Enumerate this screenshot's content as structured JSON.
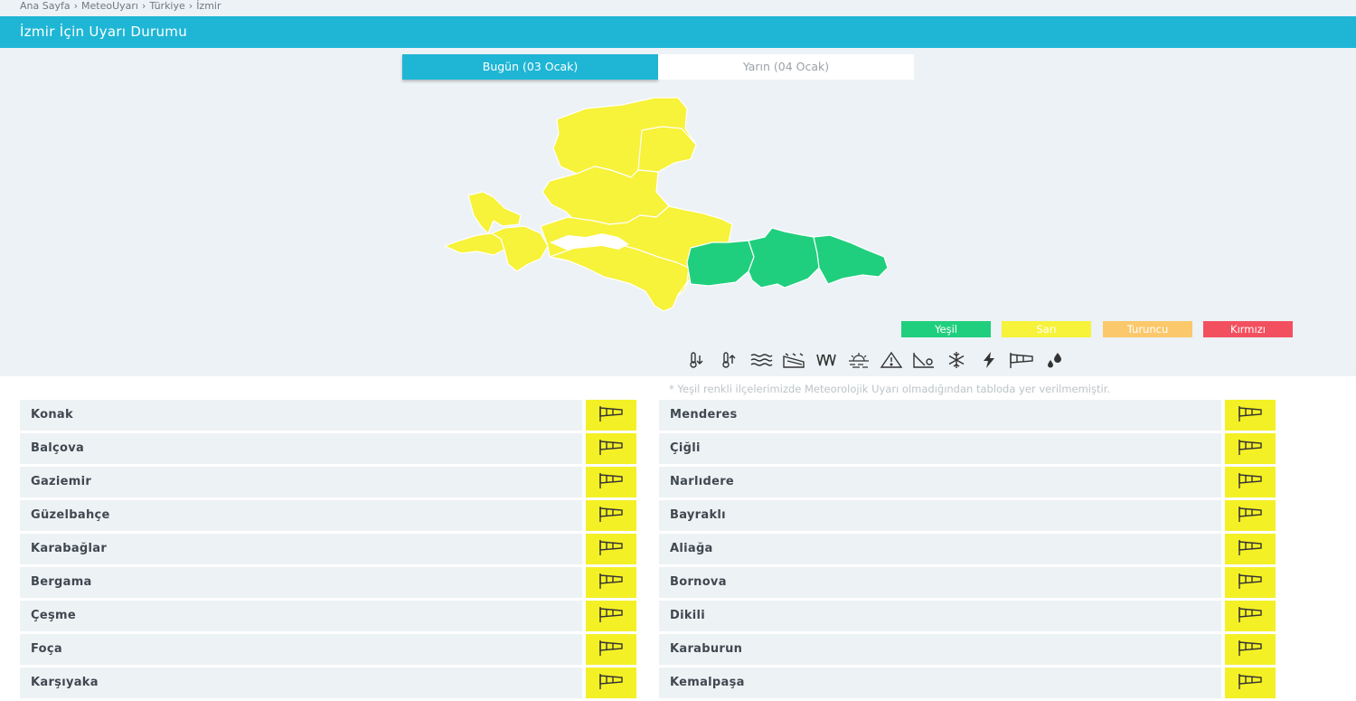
{
  "breadcrumb": [
    "Ana Sayfa",
    "MeteoUyarı",
    "Türkiye",
    "İzmir"
  ],
  "breadcrumb_sep": "›",
  "title": "İzmir İçin Uyarı Durumu",
  "tabs": [
    {
      "label": "Bugün (03 Ocak)",
      "active": true
    },
    {
      "label": "Yarın (04 Ocak)",
      "active": false
    }
  ],
  "legend": [
    {
      "label": "Yeşil",
      "color": "#20cf7d"
    },
    {
      "label": "Sarı",
      "color": "#f7f23a"
    },
    {
      "label": "Turuncu",
      "color": "#fbc86b"
    },
    {
      "label": "Kırmızı",
      "color": "#f3505f"
    }
  ],
  "weather_icons": [
    "cold-icon",
    "heat-icon",
    "fog-icon",
    "avalanche-icon",
    "rain-icon",
    "dust-icon",
    "hazard-icon",
    "landslide-icon",
    "snow-icon",
    "lightning-icon",
    "wind-icon",
    "hail-icon"
  ],
  "note": "* Yeşil renkli ilçelerimizde Meteorolojik Uyarı olmadığından tabloda yer verilmemiştir.",
  "districts_left": [
    "Konak",
    "Balçova",
    "Gaziemir",
    "Güzelbahçe",
    "Karabağlar",
    "Bergama",
    "Çeşme",
    "Foça",
    "Karşıyaka"
  ],
  "districts_right": [
    "Menderes",
    "Çiğli",
    "Narlıdere",
    "Bayraklı",
    "Aliağa",
    "Bornova",
    "Dikili",
    "Karaburun",
    "Kemalpaşa"
  ],
  "warning_icon": "wind-icon",
  "warning_level_color": "#f4f026"
}
